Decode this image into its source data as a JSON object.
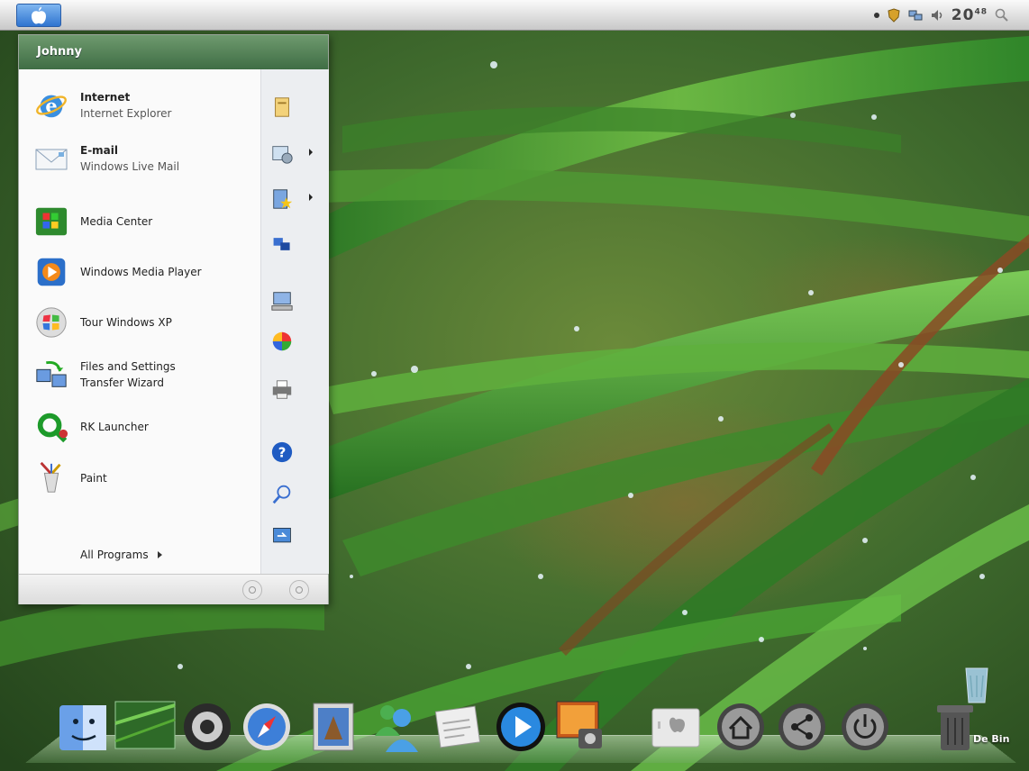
{
  "menubar": {
    "clock": "20",
    "clock_sup": "48"
  },
  "start_menu": {
    "user_name": "Johnny",
    "pinned": [
      {
        "title": "Internet",
        "subtitle": "Internet Explorer",
        "icon": "internet-explorer-icon"
      },
      {
        "title": "E-mail",
        "subtitle": "Windows Live Mail",
        "icon": "mail-icon"
      }
    ],
    "recent": [
      {
        "title": "Media Center",
        "icon": "media-center-icon"
      },
      {
        "title": "Windows Media Player",
        "icon": "media-player-icon"
      },
      {
        "title": "Tour Windows XP",
        "icon": "tour-icon"
      },
      {
        "title": "Files and Settings",
        "subtitle": "Transfer Wizard",
        "icon": "transfer-wizard-icon"
      },
      {
        "title": "RK Launcher",
        "icon": "rk-launcher-icon"
      },
      {
        "title": "Paint",
        "icon": "paint-icon"
      }
    ],
    "all_programs": "All Programs",
    "places_icons": [
      "documents-icon",
      "pictures-icon",
      "favorites-icon",
      "network-icon",
      "computer-icon",
      "control-panel-icon",
      "printers-icon",
      "help-icon",
      "search-icon",
      "run-icon"
    ]
  },
  "dock": {
    "items": [
      "finder-icon",
      "desktop-thumbnail-icon",
      "camera-icon",
      "safari-icon",
      "mail-stamp-icon",
      "messenger-icon",
      "notes-icon",
      "media-player-icon",
      "photo-slideshow-icon",
      "mac-computer-icon",
      "home-icon",
      "share-icon",
      "power-icon",
      "trash-icon"
    ],
    "trash_label": "De Bin"
  },
  "colors": {
    "wallpaper": "#4a7a33",
    "menu_header": "#4f7d52",
    "menubar": "#dcdcdc"
  }
}
